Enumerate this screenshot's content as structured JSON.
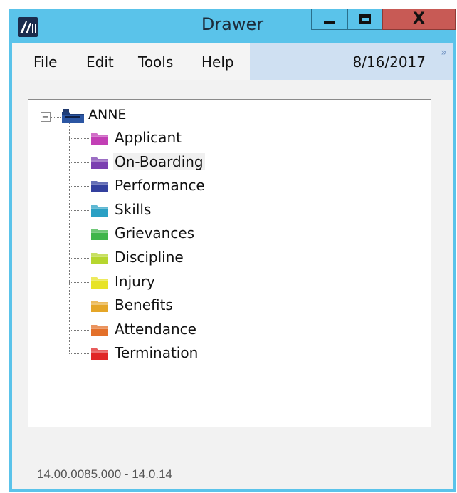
{
  "window": {
    "title": "Drawer",
    "close_glyph": "X"
  },
  "menu": {
    "items": [
      "File",
      "Edit",
      "Tools",
      "Help"
    ],
    "date": "8/16/2017",
    "overflow_glyph": "»"
  },
  "tree": {
    "expander_glyph": "−",
    "root": {
      "label": "ANNE",
      "icon": "blue-drawer-icon",
      "color": "#1e3e7a"
    },
    "items": [
      {
        "label": "Applicant",
        "color": "#c23fb5"
      },
      {
        "label": "On-Boarding",
        "color": "#7b3eb0",
        "selected": true
      },
      {
        "label": "Performance",
        "color": "#33409e"
      },
      {
        "label": "Skills",
        "color": "#2aa0c4"
      },
      {
        "label": "Grievances",
        "color": "#3fb54a"
      },
      {
        "label": "Discipline",
        "color": "#b6d62f"
      },
      {
        "label": "Injury",
        "color": "#e7e327"
      },
      {
        "label": "Benefits",
        "color": "#e5a628"
      },
      {
        "label": "Attendance",
        "color": "#e3702a"
      },
      {
        "label": "Termination",
        "color": "#e02626"
      }
    ]
  },
  "footer": {
    "version": "14.00.0085.000 - 14.0.14"
  },
  "colors": {
    "titlebar": "#5ac3ea",
    "close_button": "#c85a55",
    "menubar_date_bg": "#cfe0f2"
  }
}
